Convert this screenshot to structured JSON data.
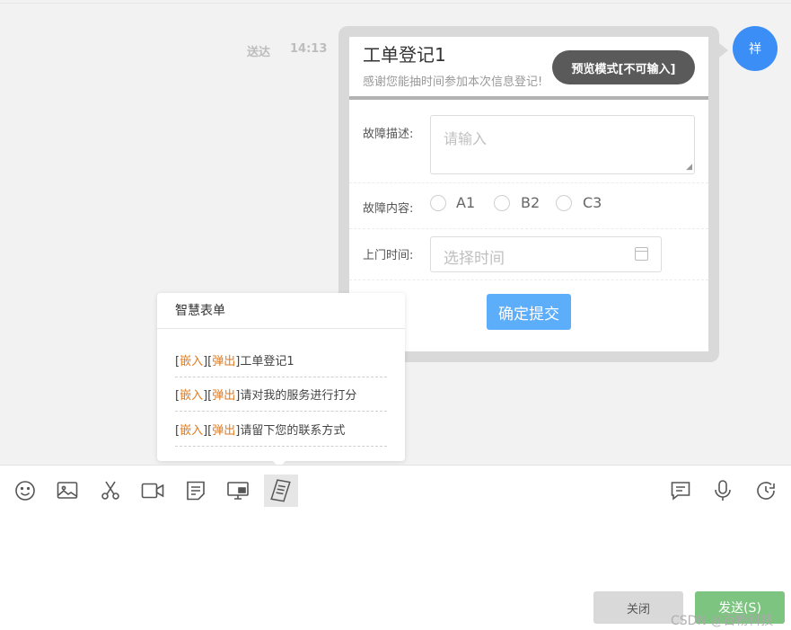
{
  "message": {
    "status": "送达",
    "time": "14:13",
    "avatar_text": "祥"
  },
  "form": {
    "title": "工单登记1",
    "subtitle": "感谢您能抽时间参加本次信息登记!",
    "preview_badge": "预览模式[不可输入]",
    "fields": {
      "fault_desc_label": "故障描述:",
      "fault_desc_placeholder": "请输入",
      "fault_content_label": "故障内容:",
      "options": [
        "A1",
        "B2",
        "C3"
      ],
      "visit_time_label": "上门时间:",
      "visit_time_placeholder": "选择时间"
    },
    "submit_label": "确定提交"
  },
  "smart_form_popup": {
    "title": "智慧表单",
    "items": [
      {
        "tag1": "嵌入",
        "tag2": "弹出",
        "name": "工单登记1"
      },
      {
        "tag1": "嵌入",
        "tag2": "弹出",
        "name": "请对我的服务进行打分"
      },
      {
        "tag1": "嵌入",
        "tag2": "弹出",
        "name": "请留下您的联系方式"
      }
    ]
  },
  "toolbar": {
    "left_icons": [
      "emoji-icon",
      "image-icon",
      "scissors-icon",
      "video-icon",
      "note-icon",
      "screen-share-icon",
      "smart-form-icon"
    ],
    "right_icons": [
      "message-icon",
      "microphone-icon",
      "history-icon"
    ]
  },
  "actions": {
    "close_label": "关闭",
    "send_label": "发送(S)"
  },
  "watermark": "CSDN @百畅科技",
  "colors": {
    "accent": "#3a8ef6",
    "submit": "#5cadfa",
    "send": "#7cc47f",
    "tag": "#e07a1f"
  }
}
